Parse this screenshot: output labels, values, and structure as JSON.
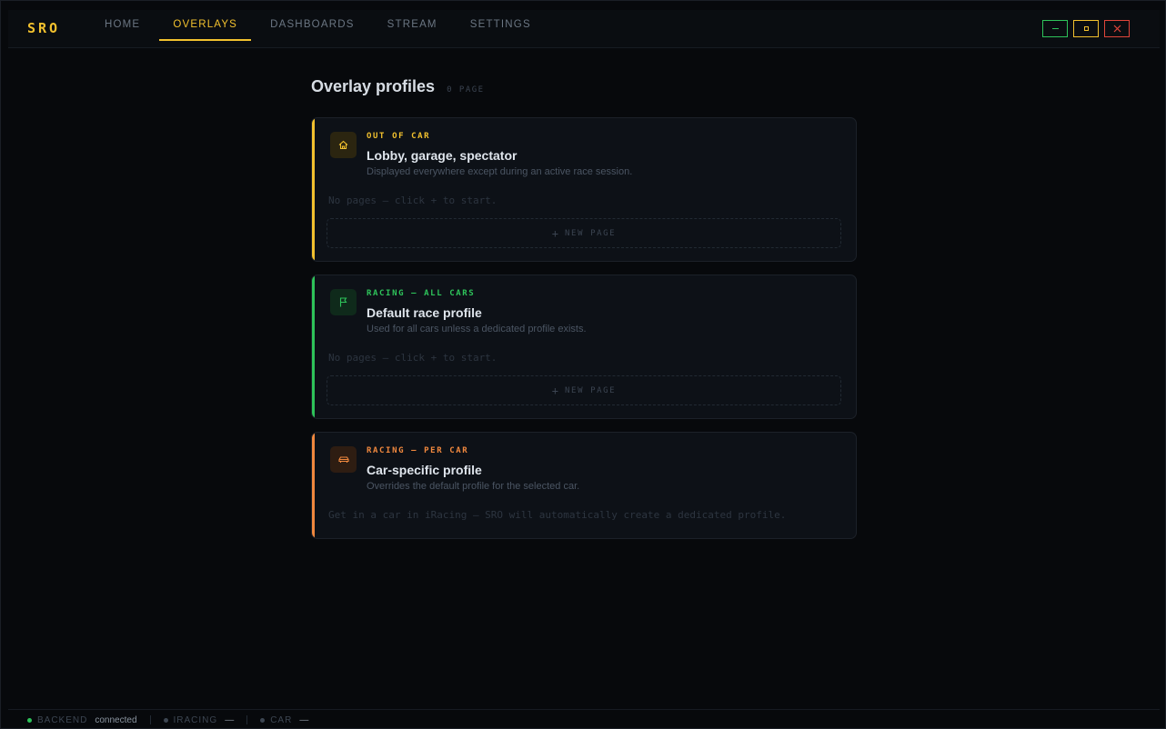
{
  "app": {
    "logo": "SRO"
  },
  "nav": {
    "items": [
      {
        "label": "HOME",
        "active": false
      },
      {
        "label": "OVERLAYS",
        "active": true
      },
      {
        "label": "DASHBOARDS",
        "active": false
      },
      {
        "label": "STREAM",
        "active": false
      },
      {
        "label": "SETTINGS",
        "active": false
      }
    ]
  },
  "window_controls": {
    "minimize_color": "#2ec35a",
    "maximize_color": "#f2c12e",
    "close_color": "#e0453a"
  },
  "page": {
    "title": "Overlay profiles",
    "count": "0 PAGE"
  },
  "profiles": [
    {
      "category": "OUT OF CAR",
      "title": "Lobby, garage, spectator",
      "subtitle": "Displayed everywhere except during an active race session.",
      "empty_text": "No pages — click + to start.",
      "new_page_label": "NEW PAGE",
      "accent": "#f2c12e",
      "icon": "home-icon"
    },
    {
      "category": "RACING — ALL CARS",
      "title": "Default race profile",
      "subtitle": "Used for all cars unless a dedicated profile exists.",
      "empty_text": "No pages — click + to start.",
      "new_page_label": "NEW PAGE",
      "accent": "#2ec35a",
      "icon": "flag-icon"
    },
    {
      "category": "RACING — PER CAR",
      "title": "Car-specific profile",
      "subtitle": "Overrides the default profile for the selected car.",
      "empty_text": "Get in a car in iRacing — SRO will automatically create a dedicated profile.",
      "accent": "#f0883e",
      "icon": "car-icon"
    }
  ],
  "status": {
    "backend": {
      "label": "BACKEND",
      "value": "connected",
      "color": "#2ec35a"
    },
    "iracing": {
      "label": "IRACING",
      "value": "—",
      "color": "#3d4652"
    },
    "car": {
      "label": "CAR",
      "value": "—",
      "color": "#3d4652"
    }
  }
}
